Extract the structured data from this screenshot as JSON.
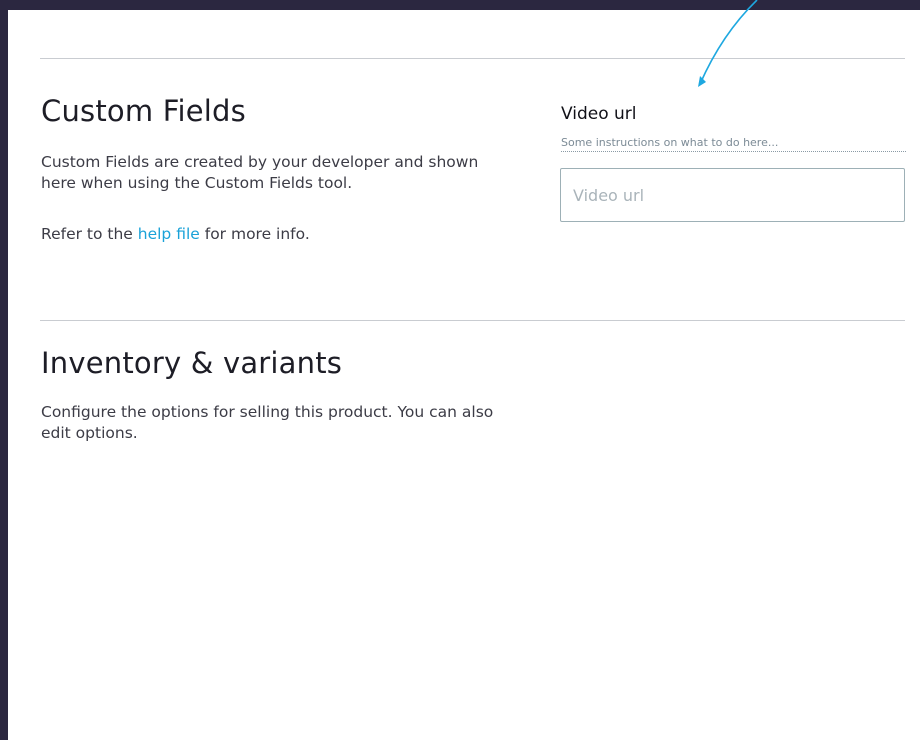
{
  "custom_fields": {
    "title": "Custom Fields",
    "description": "Custom Fields are created by your developer and shown here when using the Custom Fields tool.",
    "help_prefix": "Refer to the ",
    "help_link": "help file",
    "help_suffix": " for more info."
  },
  "video_field": {
    "label": "Video url",
    "instructions": "Some instructions on what to do here...",
    "placeholder": "Video url",
    "value": ""
  },
  "inventory": {
    "title": "Inventory & variants",
    "description": "Configure the options for selling this product. You can also edit options."
  },
  "colors": {
    "frame": "#2b2740",
    "panel": "#ffffff",
    "link": "#1aa2d8",
    "annotation_arrow": "#1ea8e0",
    "divider": "#c9ccd1"
  },
  "icons": {
    "annotation": "arrow-pointer-icon"
  }
}
